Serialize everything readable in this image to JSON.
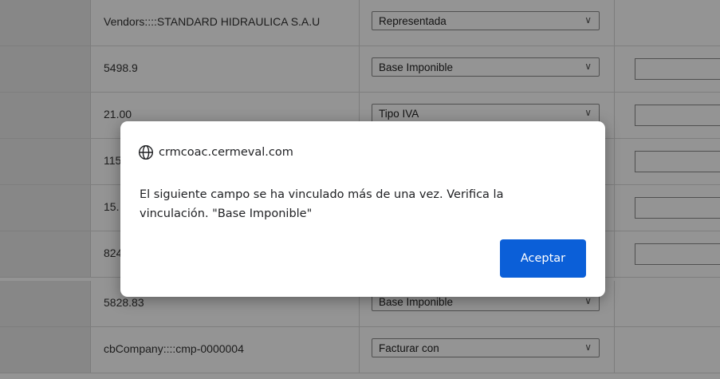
{
  "rows": [
    {
      "value": "Vendors::::STANDARD HIDRAULICA S.A.U",
      "select": "Representada",
      "has_input": false
    },
    {
      "value": "5498.9",
      "select": "Base Imponible",
      "has_input": true
    },
    {
      "value": "21.00",
      "select": "Tipo IVA",
      "has_input": true
    },
    {
      "value": "115",
      "select": "",
      "has_input": true
    },
    {
      "value": "15.",
      "select": "",
      "has_input": true
    },
    {
      "value": "824",
      "select": "",
      "has_input": true
    },
    {
      "value": "5828.83",
      "select": "Base Imponible",
      "has_input": false
    },
    {
      "value": "cbCompany::::cmp-0000004",
      "select": "Facturar con",
      "has_input": false
    }
  ],
  "dialog": {
    "origin": "crmcoac.cermeval.com",
    "message": "El siguiente campo se ha vinculado más de una vez. Verifica la vinculación. \"Base Imponible\"",
    "accept_label": "Aceptar"
  },
  "icons": {
    "globe": "globe-icon",
    "chevron": "chevron-down-icon"
  },
  "colors": {
    "accept_button": "#0b5fd8",
    "overlay": "rgba(0,0,0,0.42)"
  }
}
